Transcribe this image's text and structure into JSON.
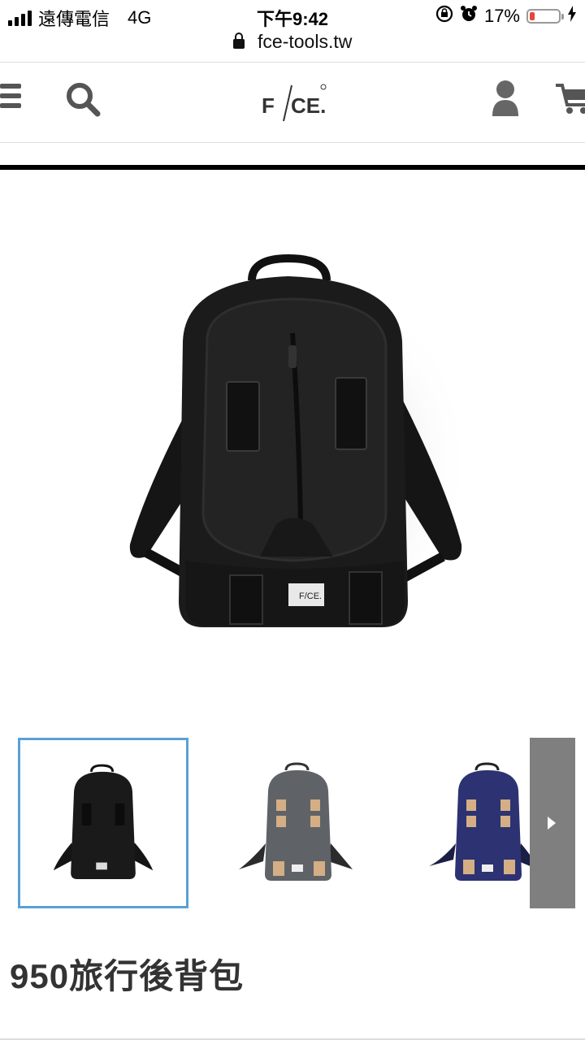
{
  "status_bar": {
    "carrier": "遠傳電信",
    "network": "4G",
    "time": "下午9:42",
    "battery": "17%",
    "battery_level": 0.17
  },
  "browser": {
    "url": "fce-tools.tw"
  },
  "header": {
    "logo_text": "F/CE."
  },
  "gallery": {
    "main_image": "black-backpack-photo",
    "thumbnails": [
      {
        "name": "black-backpack",
        "color": "#1a1a1a",
        "selected": true
      },
      {
        "name": "grey-backpack",
        "color": "#5f6367",
        "selected": false
      },
      {
        "name": "navy-backpack",
        "color": "#2c3272",
        "selected": false
      }
    ],
    "accent_color": "#5aa0d6"
  },
  "product": {
    "title": "950旅行後背包"
  }
}
